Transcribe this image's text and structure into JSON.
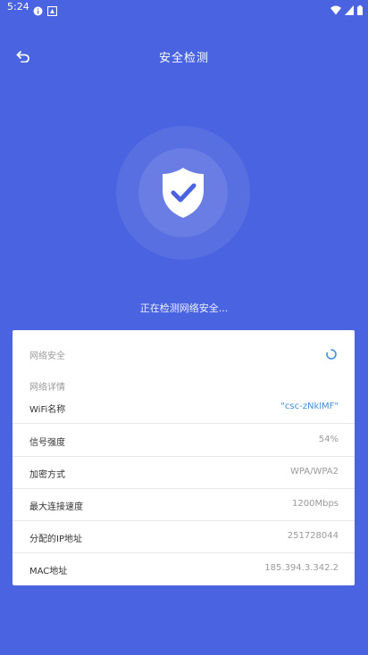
{
  "status_bar": {
    "time": "5:24"
  },
  "header": {
    "title": "安全检测"
  },
  "scan": {
    "status_text": "正在检测网络安全..."
  },
  "card": {
    "network_security_label": "网络安全",
    "details_label": "网络详情",
    "rows": [
      {
        "label": "WiFi名称",
        "value": "\"csc-zNklMF\""
      },
      {
        "label": "信号强度",
        "value": "54%"
      },
      {
        "label": "加密方式",
        "value": "WPA/WPA2"
      },
      {
        "label": "最大连接速度",
        "value": "1200Mbps"
      },
      {
        "label": "分配的IP地址",
        "value": "251728044"
      },
      {
        "label": "MAC地址",
        "value": "185.394.3.342.2"
      }
    ]
  },
  "colors": {
    "background": "#4a63e0",
    "shield": "#4a63e0",
    "accent_value": "#3f8ddf",
    "spinner": "#3f8ddf"
  },
  "icons": {
    "back": "back-arrow-icon",
    "shield": "shield-check-icon",
    "spinner": "loading-spinner-icon",
    "wifi": "wifi-icon",
    "battery": "battery-icon"
  }
}
